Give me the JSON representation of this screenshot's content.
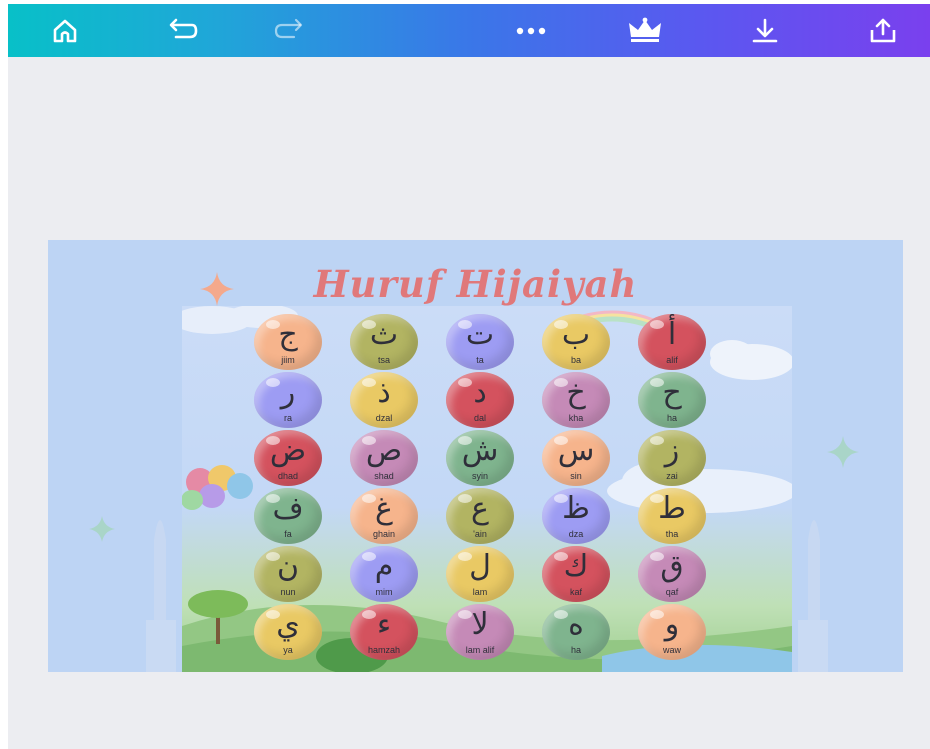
{
  "toolbar": {
    "icons": [
      "home-icon",
      "undo-icon",
      "redo-icon",
      "more-icon",
      "crown-icon",
      "download-icon",
      "share-icon"
    ]
  },
  "design": {
    "title": "Huruf Hijaiyah",
    "letters": [
      {
        "ar": "ج",
        "lat": "jiim",
        "color": "#f6b48c"
      },
      {
        "ar": "ث",
        "lat": "tsa",
        "color": "#b2b462"
      },
      {
        "ar": "ت",
        "lat": "ta",
        "color": "#9d9cf3"
      },
      {
        "ar": "ب",
        "lat": "ba",
        "color": "#e9c964"
      },
      {
        "ar": "أ",
        "lat": "alif",
        "color": "#d4525e"
      },
      {
        "ar": "ر",
        "lat": "ra",
        "color": "#9d9cf3"
      },
      {
        "ar": "ذ",
        "lat": "dzal",
        "color": "#e9c964"
      },
      {
        "ar": "د",
        "lat": "dal",
        "color": "#d4525e"
      },
      {
        "ar": "خ",
        "lat": "kha",
        "color": "#c58ab7"
      },
      {
        "ar": "ح",
        "lat": "ha",
        "color": "#7fb48e"
      },
      {
        "ar": "ض",
        "lat": "dhad",
        "color": "#d4525e"
      },
      {
        "ar": "ص",
        "lat": "shad",
        "color": "#c58ab7"
      },
      {
        "ar": "ش",
        "lat": "syin",
        "color": "#7fb48e"
      },
      {
        "ar": "س",
        "lat": "sin",
        "color": "#f6b48c"
      },
      {
        "ar": "ز",
        "lat": "zai",
        "color": "#b2b462"
      },
      {
        "ar": "ف",
        "lat": "fa",
        "color": "#7fb48e"
      },
      {
        "ar": "غ",
        "lat": "ghain",
        "color": "#f6b48c"
      },
      {
        "ar": "ع",
        "lat": "'ain",
        "color": "#b2b462"
      },
      {
        "ar": "ظ",
        "lat": "dza",
        "color": "#9d9cf3"
      },
      {
        "ar": "ط",
        "lat": "tha",
        "color": "#e9c964"
      },
      {
        "ar": "ن",
        "lat": "nun",
        "color": "#b2b462"
      },
      {
        "ar": "م",
        "lat": "mim",
        "color": "#9d9cf3"
      },
      {
        "ar": "ل",
        "lat": "lam",
        "color": "#e9c964"
      },
      {
        "ar": "ك",
        "lat": "kaf",
        "color": "#d4525e"
      },
      {
        "ar": "ق",
        "lat": "qaf",
        "color": "#c58ab7"
      },
      {
        "ar": "ي",
        "lat": "ya",
        "color": "#e9c964"
      },
      {
        "ar": "ء",
        "lat": "hamzah",
        "color": "#d4525e"
      },
      {
        "ar": "لا",
        "lat": "lam alif",
        "color": "#c58ab7"
      },
      {
        "ar": "ه",
        "lat": "ha",
        "color": "#7fb48e"
      },
      {
        "ar": "و",
        "lat": "waw",
        "color": "#f6b48c"
      }
    ]
  },
  "colors": {
    "toolbar_start": "#08c0c8",
    "toolbar_end": "#7a40ee",
    "workspace": "#ecedf1",
    "canvas": "#bdd4f4",
    "title": "#e0787a"
  }
}
